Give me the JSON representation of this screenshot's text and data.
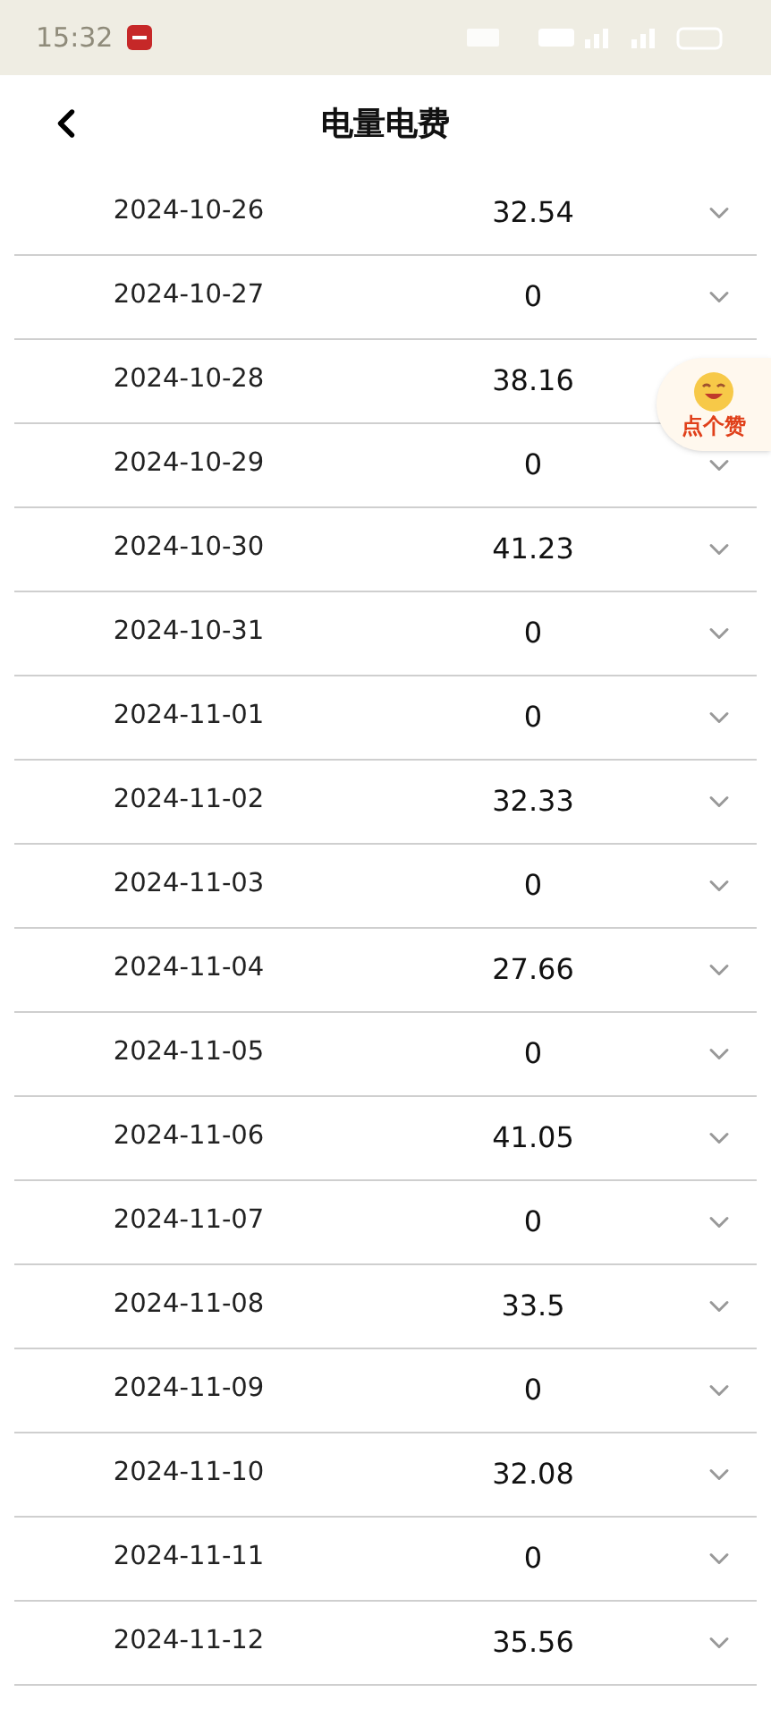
{
  "status_bar": {
    "time": "15:32"
  },
  "header": {
    "title": "电量电费"
  },
  "rows": [
    {
      "date": "2024-10-26",
      "value": "32.54"
    },
    {
      "date": "2024-10-27",
      "value": "0"
    },
    {
      "date": "2024-10-28",
      "value": "38.16",
      "chevron_covered": true
    },
    {
      "date": "2024-10-29",
      "value": "0"
    },
    {
      "date": "2024-10-30",
      "value": "41.23"
    },
    {
      "date": "2024-10-31",
      "value": "0"
    },
    {
      "date": "2024-11-01",
      "value": "0"
    },
    {
      "date": "2024-11-02",
      "value": "32.33"
    },
    {
      "date": "2024-11-03",
      "value": "0"
    },
    {
      "date": "2024-11-04",
      "value": "27.66"
    },
    {
      "date": "2024-11-05",
      "value": "0"
    },
    {
      "date": "2024-11-06",
      "value": "41.05"
    },
    {
      "date": "2024-11-07",
      "value": "0"
    },
    {
      "date": "2024-11-08",
      "value": "33.5"
    },
    {
      "date": "2024-11-09",
      "value": "0"
    },
    {
      "date": "2024-11-10",
      "value": "32.08"
    },
    {
      "date": "2024-11-11",
      "value": "0"
    },
    {
      "date": "2024-11-12",
      "value": "35.56"
    }
  ],
  "like_badge": {
    "label": "点个赞"
  }
}
